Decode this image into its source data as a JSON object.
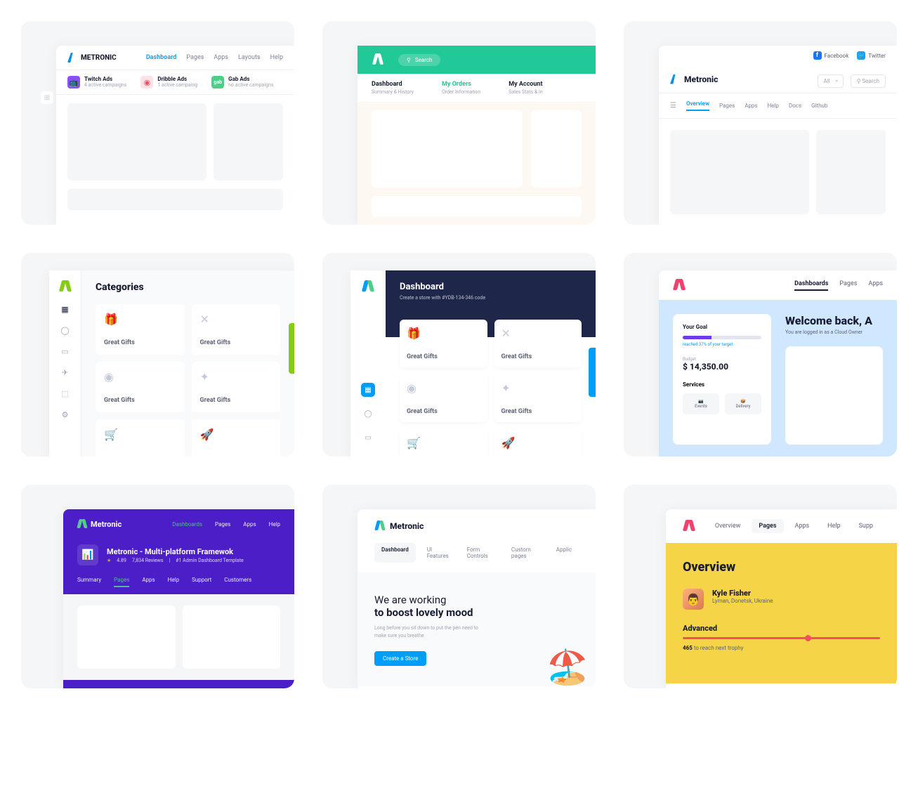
{
  "c1": {
    "brand": "METRONIC",
    "nav": [
      "Dashboard",
      "Pages",
      "Apps",
      "Layouts",
      "Help"
    ],
    "tabs": [
      {
        "title": "Twitch Ads",
        "sub": "4 active campaigns",
        "badge": "📺"
      },
      {
        "title": "Dribble Ads",
        "sub": "1 active campaing",
        "badge": "◉"
      },
      {
        "title": "Gab Ads",
        "sub": "no active campaigns",
        "badge": "gab"
      }
    ]
  },
  "c2": {
    "search": "Search",
    "tabs": [
      {
        "title": "Dashboard",
        "sub": "Summary & History"
      },
      {
        "title": "My Orders",
        "sub": "Order Information"
      },
      {
        "title": "My Account",
        "sub": "Sales Stats & In"
      }
    ]
  },
  "c3": {
    "social": [
      "Facebook",
      "Twitter"
    ],
    "brand": "Metronic",
    "filter": "All",
    "search": "Search",
    "nav": [
      "Overview",
      "Pages",
      "Apps",
      "Help",
      "Docs",
      "Github"
    ]
  },
  "c4": {
    "title": "Categories",
    "items": [
      "Great Gifts",
      "Great Gifts",
      "Great Gifts",
      "Great Gifts",
      "",
      ""
    ]
  },
  "c5": {
    "title": "Dashboard",
    "sub": "Create a store with #YDB-134-346 code",
    "items": [
      "Great Gifts",
      "Great Gifts",
      "Great Gifts",
      "Great Gifts",
      "",
      ""
    ]
  },
  "c6": {
    "nav": [
      "Dashboards",
      "Pages",
      "Apps"
    ],
    "welcome": "Welcome back, A",
    "welcome_sub": "You are logged in as a Cloud Owner",
    "goal": {
      "title": "Your Goal",
      "progress": "reached 37% of your target",
      "budget_label": "Budget",
      "budget": "$ 14,350.00",
      "services": "Services",
      "items": [
        "Events",
        "Delivery"
      ]
    }
  },
  "c7": {
    "brand": "Metronic",
    "nav": [
      "Dashboards",
      "Pages",
      "Apps",
      "Help"
    ],
    "title": "Metronic - Multi-platform  Framewok",
    "rating": "4.89",
    "reviews": "7,834 Reviews",
    "tag": "#1 Admin Dashboard Template",
    "tabs": [
      "Summary",
      "Pages",
      "Apps",
      "Help",
      "Support",
      "Customers"
    ]
  },
  "c8": {
    "brand": "Metronic",
    "tabs": [
      "Dashboard",
      "UI Features",
      "Form Controls",
      "Custom pages",
      "Applic"
    ],
    "title_line1": "We are working",
    "title_line2": "to boost lovely mood",
    "sub": "Long before you sit down to put the pen need to make sure you breathe",
    "button": "Create a Store"
  },
  "c9": {
    "nav": [
      "Overview",
      "Pages",
      "Apps",
      "Help",
      "Supp"
    ],
    "title": "Overview",
    "user": {
      "name": "Kyle Fisher",
      "location": "Lyman, Donetsk, Ukraine"
    },
    "level": "Advanced",
    "trophy_count": "465",
    "trophy_text": "to reach next trophy"
  }
}
